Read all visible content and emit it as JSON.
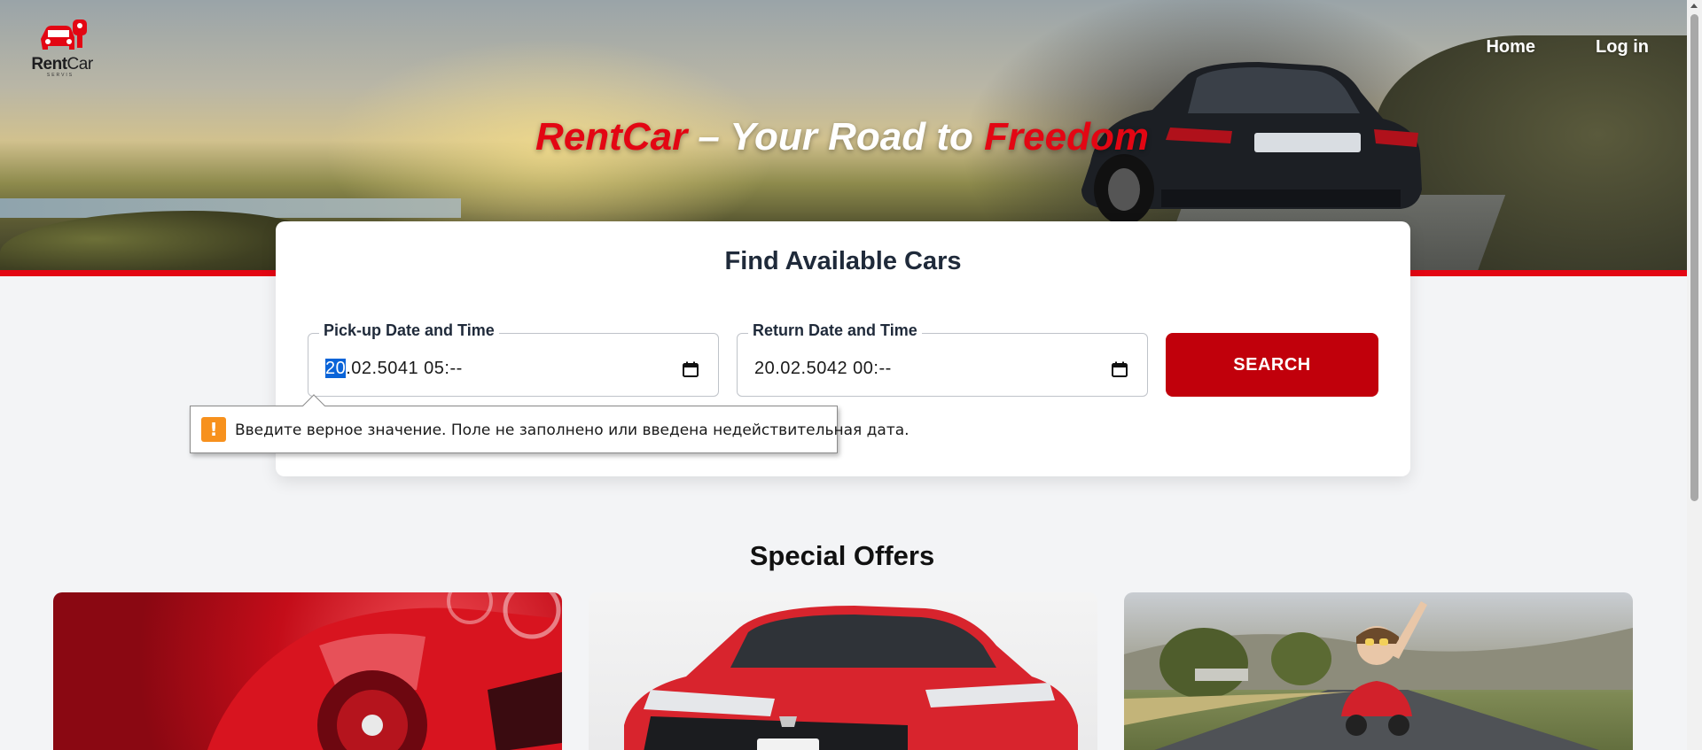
{
  "brand": {
    "logo_text_bold": "Rent",
    "logo_text_light": "Car",
    "logo_subtext": "SERVIS",
    "primary_red": "#e30613",
    "button_red": "#c1000b"
  },
  "nav": {
    "home": "Home",
    "login": "Log in"
  },
  "hero": {
    "title_brand": "RentCar",
    "title_middle": " – Your Road to ",
    "title_end": "Freedom"
  },
  "search": {
    "title": "Find Available Cars",
    "pickup": {
      "label": "Pick-up Date and Time",
      "value_selected": "20",
      "value_rest": ".02.5041 05:--",
      "icon": "calendar-icon"
    },
    "return": {
      "label": "Return Date and Time",
      "value": "20.02.5042 00:--",
      "icon": "calendar-icon"
    },
    "button": "SEARCH"
  },
  "validation": {
    "icon": "warning-icon",
    "icon_glyph": "!",
    "message": "Введите верное значение. Поле не заполнено или введена недействительная дата."
  },
  "offers": {
    "title": "Special Offers",
    "items": [
      {
        "image": "red-sports-car-image"
      },
      {
        "image": "red-sedan-image"
      },
      {
        "image": "child-in-toy-car-image"
      }
    ]
  }
}
